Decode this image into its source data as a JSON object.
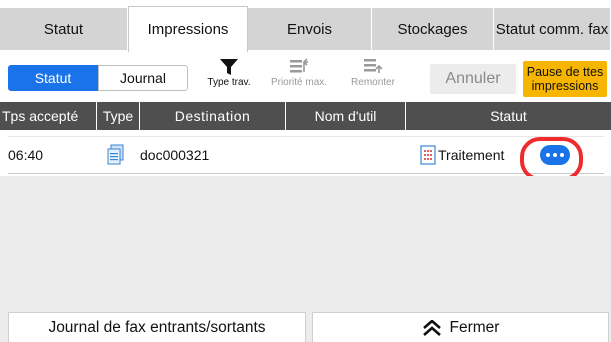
{
  "tabs": [
    {
      "label": "Statut"
    },
    {
      "label": "Impressions"
    },
    {
      "label": "Envois"
    },
    {
      "label": "Stockages"
    },
    {
      "label": "Statut comm. fax"
    }
  ],
  "active_tab": "Impressions",
  "toolbar": {
    "segments": [
      "Statut",
      "Journal"
    ],
    "selected_segment": "Statut",
    "type_trav_label": "Type trav.",
    "priorite_label": "Priorité max.",
    "remonter_label": "Remonter",
    "annuler_label": "Annuler",
    "pause_label": "Pause de ttes impressions"
  },
  "table": {
    "headers": [
      "Tps accepté",
      "Type",
      "Destination",
      "Nom d'util",
      "Statut"
    ],
    "rows": [
      {
        "time": "06:40",
        "type_icon": "document-icon",
        "destination": "doc000321",
        "user": "",
        "status_icon": "print-job-icon",
        "status": "Traitement"
      }
    ]
  },
  "bottom": {
    "journal_fax_label": "Journal de fax entrants/sortants",
    "fermer_label": "Fermer"
  },
  "colors": {
    "accent": "#1a73e8",
    "pause": "#f7b500",
    "header": "#4f4f4f",
    "highlight": "#ef2b2b"
  }
}
